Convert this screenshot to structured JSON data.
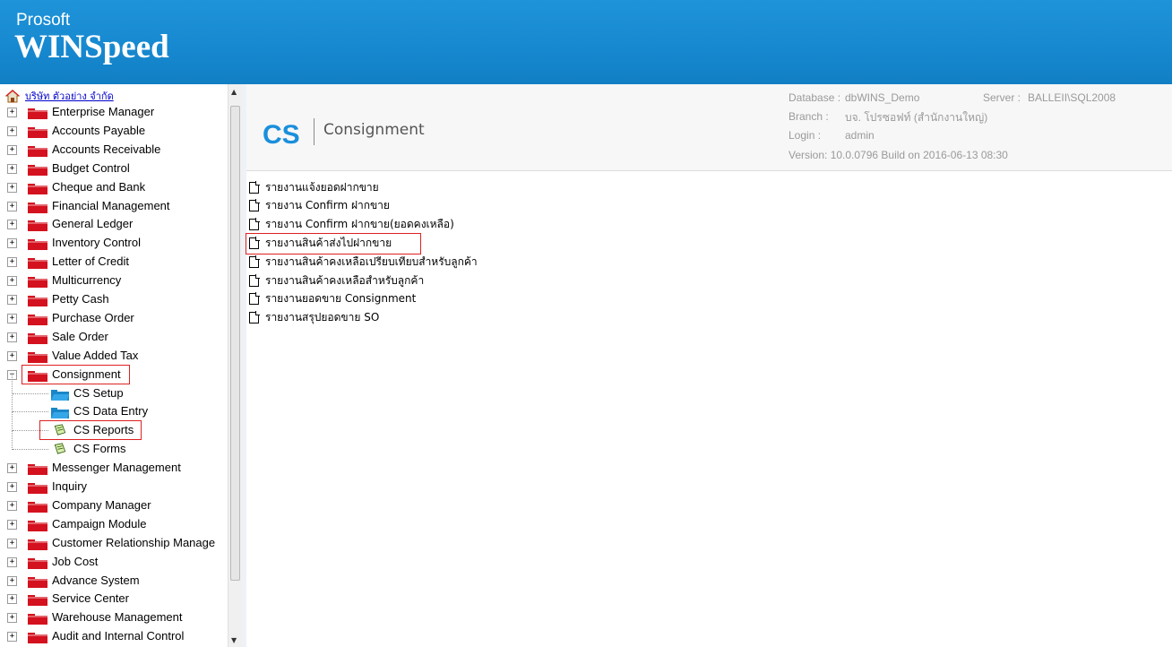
{
  "header": {
    "brand_small": "Prosoft",
    "brand_big": "WINSpeed"
  },
  "sidebar": {
    "company": "บริษัท ตัวอย่าง จำกัด",
    "items_top": [
      "Enterprise Manager",
      "Accounts Payable",
      "Accounts Receivable",
      "Budget Control",
      "Cheque and Bank",
      "Financial Management",
      "General Ledger",
      "Inventory Control",
      "Letter of Credit",
      "Multicurrency",
      "Petty Cash",
      "Purchase Order",
      "Sale Order",
      "Value Added Tax"
    ],
    "consignment": "Consignment",
    "consignment_children": [
      "CS Setup",
      "CS Data Entry",
      "CS Reports",
      "CS Forms"
    ],
    "items_bottom": [
      "Messenger Management",
      "Inquiry",
      "Company Manager",
      "Campaign Module",
      "Customer Relationship Manage",
      "Job Cost",
      "Advance System",
      "Service Center",
      "Warehouse Management",
      "Audit and Internal Control"
    ],
    "expand_symbol": "+",
    "collapse_symbol": "−"
  },
  "module": {
    "code": "CS",
    "name": "Consignment"
  },
  "info": {
    "database_label": "Database :",
    "database": "dbWINS_Demo",
    "server_label": "Server :",
    "server": "BALLEII\\SQL2008",
    "branch_label": "Branch :",
    "branch": "บจ. โปรซอฟท์ (สำนักงานใหญ่)",
    "login_label": "Login :",
    "login": "admin",
    "version": "Version: 10.0.0796  Build on 2016-06-13 08:30"
  },
  "reports": [
    "รายงานแจ้งยอดฝากขาย",
    "รายงาน Confirm ฝากขาย",
    "รายงาน Confirm ฝากขาย(ยอดคงเหลือ)",
    "รายงานสินค้าส่งไปฝากขาย",
    "รายงานสินค้าคงเหลือเปรียบเทียบสำหรับลูกค้า",
    "รายงานสินค้าคงเหลือสำหรับลูกค้า",
    "รายงานยอดขาย Consignment",
    "รายงานสรุปยอดขาย SO"
  ],
  "colors": {
    "header": "#1688cf",
    "highlight": "#e02020",
    "accent": "#1a8fdc"
  }
}
